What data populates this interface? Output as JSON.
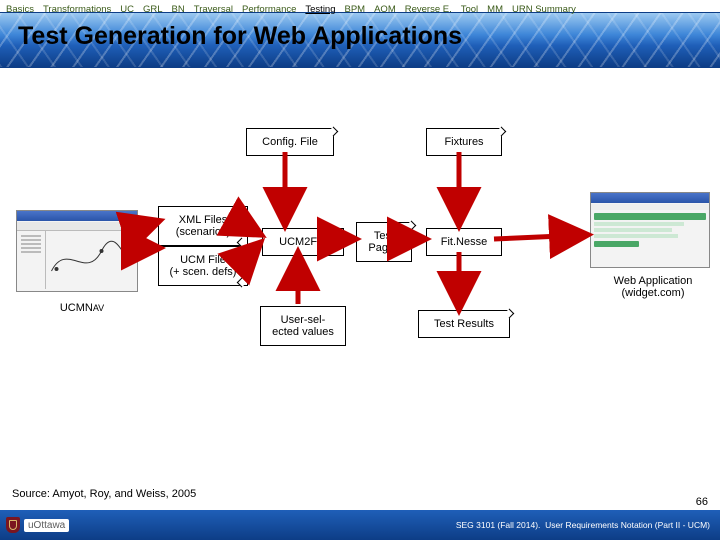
{
  "nav": {
    "items": [
      "Basics",
      "Transformations",
      "UC",
      "GRL",
      "BN",
      "Traversal",
      "Performance",
      "Testing",
      "BPM",
      "AOM",
      "Reverse E.",
      "Tool",
      "MM",
      "URN Summary"
    ],
    "activeIndex": 7
  },
  "title": "Test Generation for Web Applications",
  "nodes": {
    "config": "Config. File",
    "fixtures": "Fixtures",
    "xmlfiles": "XML Files\n(scenarios)",
    "ucmfile": "UCM File\n(+ scen. defs)",
    "ucm2fit": "UCM2FIT",
    "testpages": "Test\nPages",
    "fitnesse": "Fit.Nesse",
    "usersel": "User-sel-\nected values",
    "testresults": "Test Results",
    "ucmnav": "UCMNAV",
    "webapp": "Web Application\n(widget.com)"
  },
  "source": "Source: Amyot, Roy, and Weiss, 2005",
  "page": "66",
  "footer": {
    "course": "SEG 3101 (Fall 2014)",
    "subtitle": "User Requirements Notation (Part II - UCM)",
    "uo": "uOttawa"
  }
}
